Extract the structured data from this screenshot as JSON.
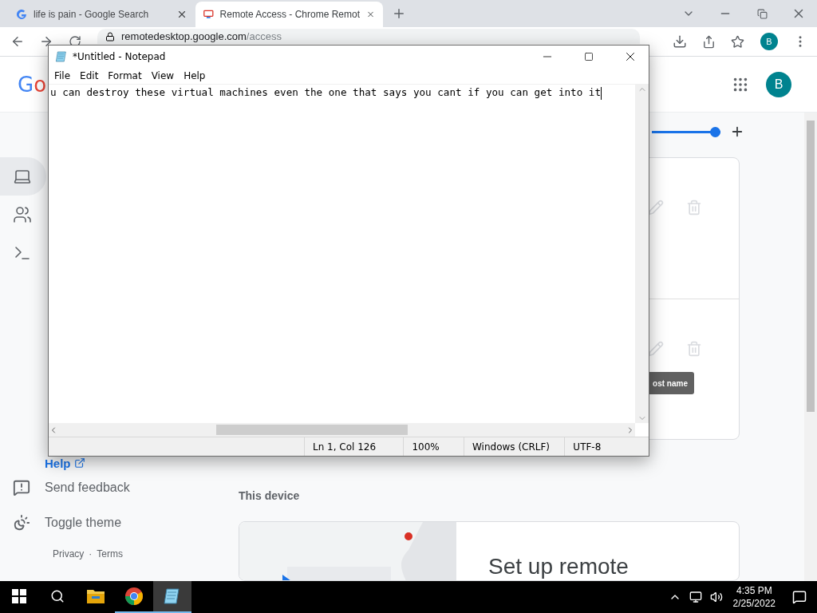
{
  "browser": {
    "tabs": [
      {
        "title": "life is pain - Google Search",
        "selected": false
      },
      {
        "title": "Remote Access - Chrome Remot",
        "selected": true
      }
    ],
    "host": "remotedesktop.google.com",
    "path": "/access",
    "profile": "B"
  },
  "page": {
    "logo": "Go",
    "avatar": "B",
    "nav": [
      {
        "selected": true
      },
      {
        "selected": false
      },
      {
        "selected": false
      }
    ],
    "help": "Help",
    "links": [
      {
        "label": "Send feedback"
      },
      {
        "label": "Toggle theme"
      }
    ],
    "footer": {
      "privacy": "Privacy",
      "separator": "·",
      "terms": "Terms"
    },
    "zoom_slider": {
      "level": 1
    },
    "tooltip": "ost name",
    "section_title": "This device",
    "setup_title": "Set up remote"
  },
  "notepad": {
    "title": "*Untitled - Notepad",
    "menu": [
      "File",
      "Edit",
      "Format",
      "View",
      "Help"
    ],
    "text": "u can destroy these virtual machines even the one that says you cant if you can get into it",
    "status": [
      "Ln 1, Col 126",
      "100%",
      "Windows (CRLF)",
      "UTF-8"
    ]
  },
  "taskbar": {
    "apps": [
      {
        "running": false,
        "selected": false
      },
      {
        "running": true,
        "selected": false
      },
      {
        "running": true,
        "selected": true
      }
    ],
    "time": "4:35 PM",
    "date": "2/25/2022"
  }
}
